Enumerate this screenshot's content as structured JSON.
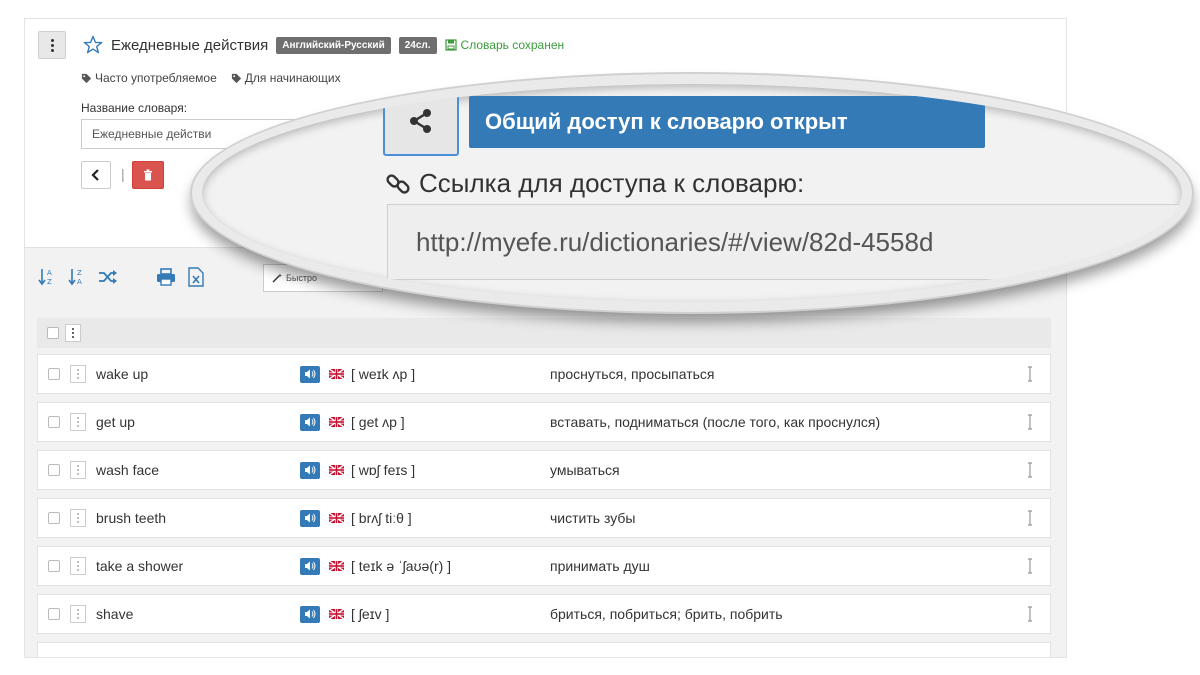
{
  "header": {
    "title": "Ежедневные действия",
    "lang_badge": "Английский-Русский",
    "count_badge": "24сл.",
    "saved_text": "Словарь сохранен"
  },
  "tags": [
    "Часто употребляемое",
    "Для начинающих"
  ],
  "form": {
    "name_label": "Название словаря:",
    "name_value": "Ежедневные действи"
  },
  "toolbar": {
    "quick_filter": "Быстро"
  },
  "share": {
    "status_label": "Общий доступ к словарю открыт",
    "link_label": "Ссылка для доступа к словарю:",
    "link_value": "http://myefe.ru/dictionaries/#/view/82d-4558d"
  },
  "words": [
    {
      "en": "wake up",
      "tr": "[ weɪk ʌp ]",
      "ru": "проснуться, просыпаться"
    },
    {
      "en": "get up",
      "tr": "[ get ʌp ]",
      "ru": "вставать, подниматься (после того, как проснулся)"
    },
    {
      "en": "wash face",
      "tr": "[ wɒʃ feɪs ]",
      "ru": "умываться"
    },
    {
      "en": "brush teeth",
      "tr": "[ brʌʃ tiːθ ]",
      "ru": "чистить зубы"
    },
    {
      "en": "take a shower",
      "tr": "[ teɪk ə ˈʃaʊə(r) ]",
      "ru": "принимать душ"
    },
    {
      "en": "shave",
      "tr": "[ ʃeɪv ]",
      "ru": "бриться, побриться; брить, побрить"
    }
  ],
  "colors": {
    "primary": "#337ab7",
    "danger": "#d9534f",
    "success": "#3c9a3c",
    "badge": "#6f6f6f"
  }
}
